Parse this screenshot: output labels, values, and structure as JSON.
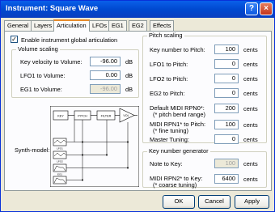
{
  "window": {
    "title": "Instrument: Square Wave"
  },
  "titlebar_buttons": {
    "help": "?",
    "close": "×"
  },
  "tabs": [
    {
      "label": "General"
    },
    {
      "label": "Layers"
    },
    {
      "label": "Articulation"
    },
    {
      "label": "LFOs"
    },
    {
      "label": "EG1"
    },
    {
      "label": "EG2"
    },
    {
      "label": "Effects"
    }
  ],
  "articulation": {
    "enable_label": "Enable instrument global articulation",
    "enable_checked": "✓",
    "volume_scaling": {
      "title": "Volume scaling",
      "rows": [
        {
          "label": "Key velocity to Volume:",
          "value": "-96.00",
          "unit": "dB"
        },
        {
          "label": "LFO1 to Volume:",
          "value": "0.00",
          "unit": "dB"
        },
        {
          "label": "EG1 to Volume:",
          "value": "-96.00",
          "unit": "dB"
        }
      ]
    },
    "synth_model_label": "Synth-model:",
    "diagram": {
      "blocks": [
        "KEY",
        "PITCH",
        "FILTER",
        "VOL"
      ],
      "lfo_labels": [
        "LFO1",
        "LFO2",
        "EG1",
        "EG2"
      ]
    },
    "pitch_scaling": {
      "title": "Pitch scaling",
      "rows": [
        {
          "label": "Key number to Pitch:",
          "value": "100",
          "unit": "cents"
        },
        {
          "label": "LFO1 to Pitch:",
          "value": "0",
          "unit": "cents"
        },
        {
          "label": "LFO2 to Pitch:",
          "value": "0",
          "unit": "cents"
        },
        {
          "label": "EG2 to Pitch:",
          "value": "0",
          "unit": "cents"
        },
        {
          "label": "Default MIDI RPN0*:",
          "label2": "(* pitch bend range)",
          "value": "200",
          "unit": "cents"
        },
        {
          "label": "MIDI RPN1* to Pitch:",
          "label2": "(* fine tuning)",
          "value": "100",
          "unit": "cents"
        },
        {
          "label": "Master Tuning:",
          "value": "0",
          "unit": "cents"
        }
      ]
    },
    "key_number_generator": {
      "title": "Key number generator",
      "rows": [
        {
          "label": "Note to Key:",
          "value": "100",
          "unit": "cents"
        },
        {
          "label": "MIDI RPN2* to Key:",
          "label2": "(* coarse tuning)",
          "value": "6400",
          "unit": "cents"
        }
      ]
    }
  },
  "buttons": {
    "ok": "OK",
    "cancel": "Cancel",
    "apply": "Apply"
  }
}
